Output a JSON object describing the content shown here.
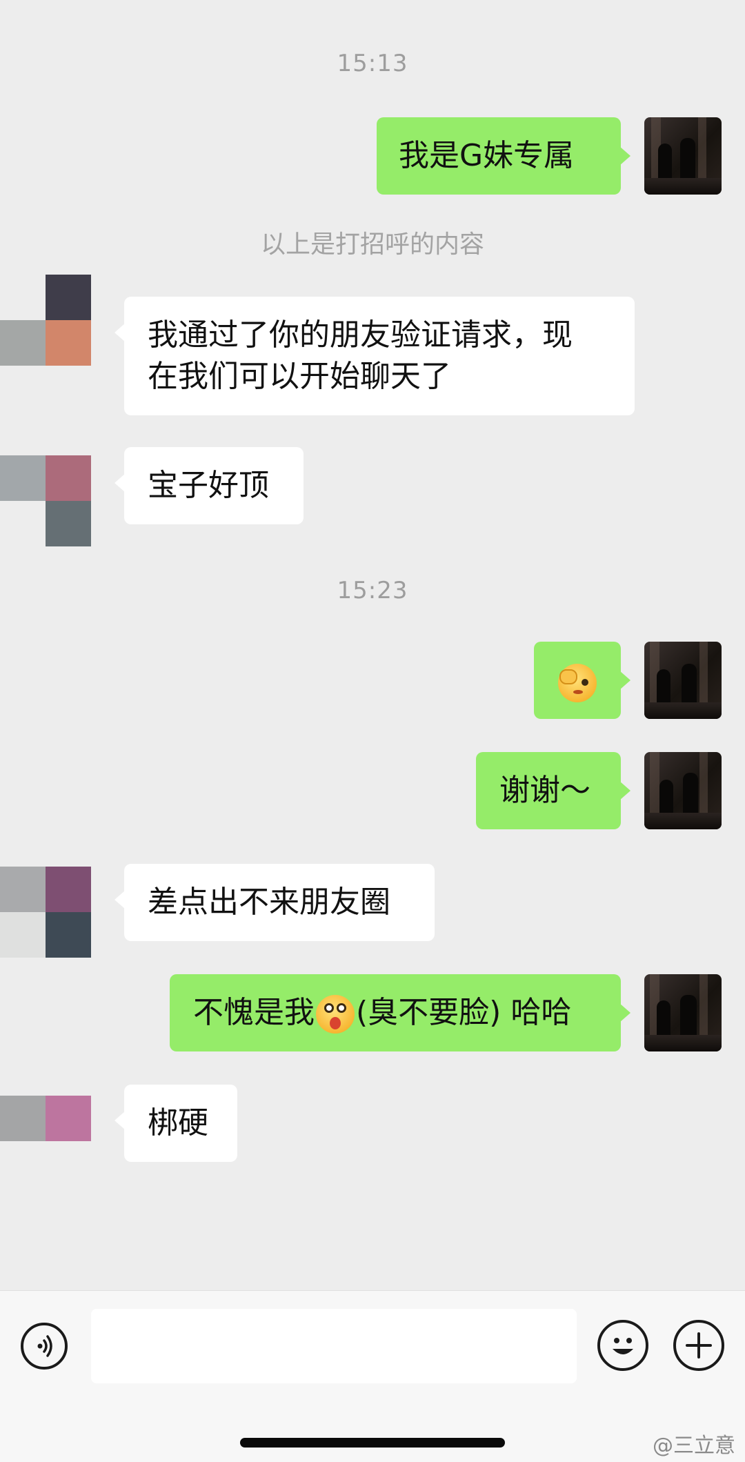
{
  "timestamps": [
    "15:13",
    "15:23"
  ],
  "system_note": "以上是打招呼的内容",
  "messages": [
    {
      "from": "self",
      "text": "我是G妹专属"
    },
    {
      "from": "peer",
      "text_lines": [
        "我通过了你的朋友验证请求，现",
        "在我们可以开始聊天了"
      ]
    },
    {
      "from": "peer",
      "text": "宝子好顶"
    },
    {
      "from": "self",
      "emoji": "winking-hand-emoji"
    },
    {
      "from": "self",
      "text": "谢谢～"
    },
    {
      "from": "peer",
      "text": "差点出不来朋友圈"
    },
    {
      "from": "self",
      "text_before": "不愧是我",
      "emoji": "tongue-out-emoji",
      "text_after": "(臭不要脸) 哈哈"
    },
    {
      "from": "peer",
      "text": "梆硬"
    }
  ],
  "input_bar": {
    "voice_icon": "voice-icon",
    "input_value": "",
    "emoji_icon": "smiley-icon",
    "more_icon": "plus-icon"
  },
  "watermark": "@三立意",
  "colors": {
    "background": "#ededed",
    "self_bubble": "#95ec69",
    "peer_bubble": "#ffffff",
    "timestamp": "#9d9d9d"
  }
}
